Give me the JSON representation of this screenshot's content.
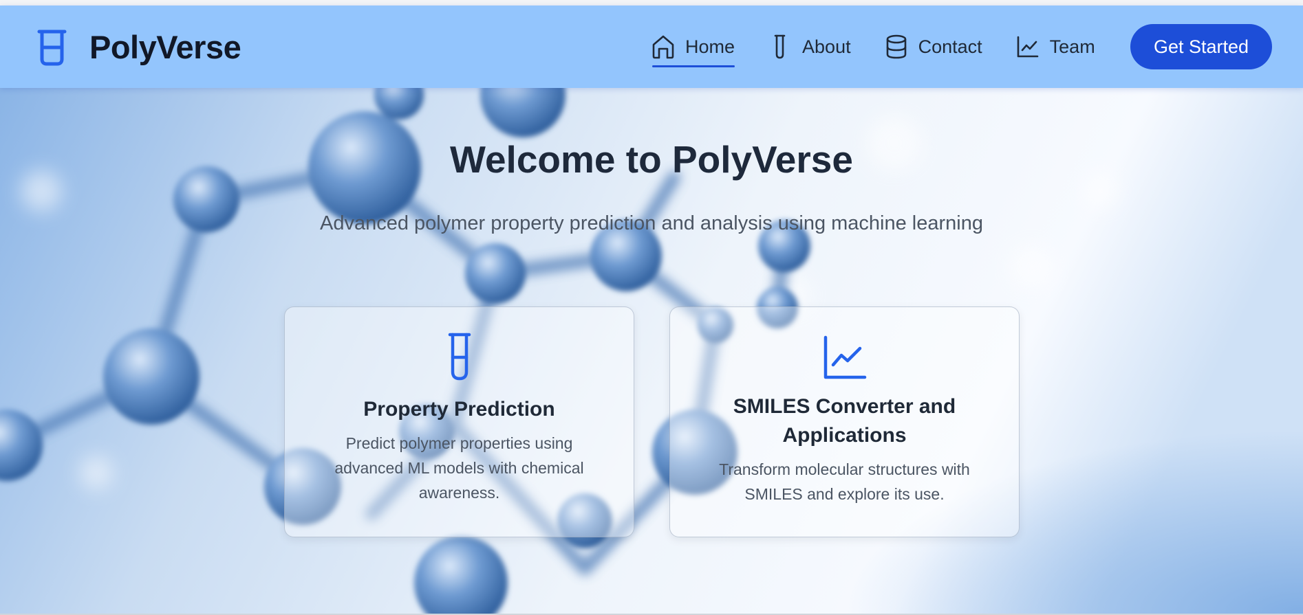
{
  "brand": {
    "name": "PolyVerse",
    "icon": "test-tube-icon"
  },
  "nav": {
    "items": [
      {
        "label": "Home",
        "icon": "home-icon",
        "active": true
      },
      {
        "label": "About",
        "icon": "test-tube-icon",
        "active": false
      },
      {
        "label": "Contact",
        "icon": "database-icon",
        "active": false
      },
      {
        "label": "Team",
        "icon": "chart-line-icon",
        "active": false
      }
    ],
    "cta_label": "Get Started"
  },
  "hero": {
    "title": "Welcome to PolyVerse",
    "subtitle": "Advanced polymer property prediction and analysis using machine learning"
  },
  "cards": [
    {
      "icon": "test-tube-icon",
      "title": "Property Prediction",
      "description": "Predict polymer properties using advanced ML models with chemical awareness."
    },
    {
      "icon": "chart-line-icon",
      "title": "SMILES Converter and Applications",
      "description": "Transform molecular structures with SMILES and explore its use."
    }
  ],
  "colors": {
    "navbar_bg": "#93c5fd",
    "accent": "#1d4ed8",
    "icon_blue": "#2563eb",
    "title_text": "#1e293b",
    "body_text": "#4b5563"
  }
}
